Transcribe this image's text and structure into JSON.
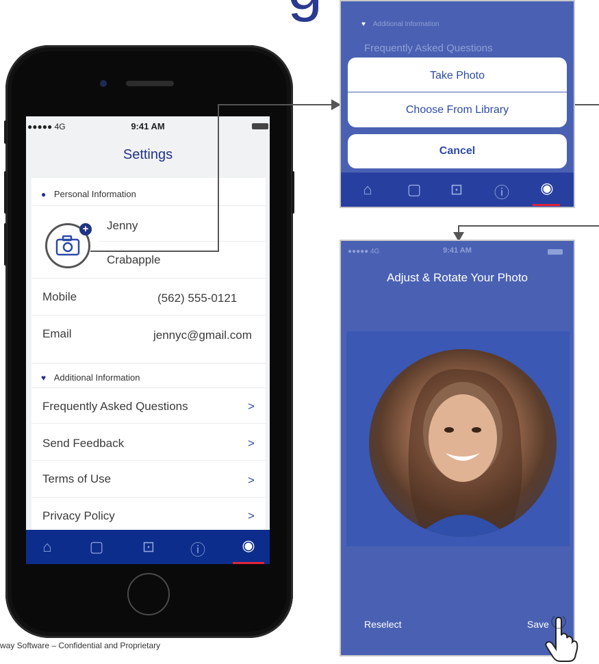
{
  "page": {
    "title_fragment": "g",
    "footer": "way Software – Confidential and Proprietary"
  },
  "phone": {
    "status": {
      "signal": "●●●●● 4G",
      "time": "9:41 AM"
    },
    "title": "Settings",
    "personal": {
      "heading": "Personal Information",
      "first_name": "Jenny",
      "last_name": "Crabapple",
      "mobile_label": "Mobile",
      "mobile_value": "(562) 555-0121",
      "email_label": "Email",
      "email_value": "jennyc@gmail.com"
    },
    "additional": {
      "heading": "Additional Information",
      "items": [
        {
          "label": "Frequently Asked Questions",
          "chevron": ">"
        },
        {
          "label": "Send Feedback",
          "chevron": ">"
        },
        {
          "label": "Terms of Use",
          "chevron": ">"
        },
        {
          "label": "Privacy Policy",
          "chevron": ">"
        }
      ]
    },
    "tabs": [
      {
        "icon": "home-icon",
        "glyph": "⌂"
      },
      {
        "icon": "book-icon",
        "glyph": "▢"
      },
      {
        "icon": "car-icon",
        "glyph": "⊡"
      },
      {
        "icon": "info-icon",
        "glyph": "ⓘ"
      },
      {
        "icon": "profile-icon",
        "glyph": "◉"
      }
    ]
  },
  "sheet_panel": {
    "section_heading": "Additional Information",
    "section_item": "Frequently Asked Questions",
    "take_photo": "Take Photo",
    "choose_library": "Choose From Library",
    "cancel": "Cancel"
  },
  "photo_panel": {
    "status": {
      "signal": "●●●●● 4G",
      "time": "9:41 AM"
    },
    "title": "Adjust & Rotate Your Photo",
    "reselect": "Reselect",
    "save": "Save"
  },
  "colors": {
    "brand_blue": "#1f3384",
    "tab_bar": "#0d2d8c",
    "panel_bg": "#4a61b3",
    "accent_red": "#e2243a"
  }
}
